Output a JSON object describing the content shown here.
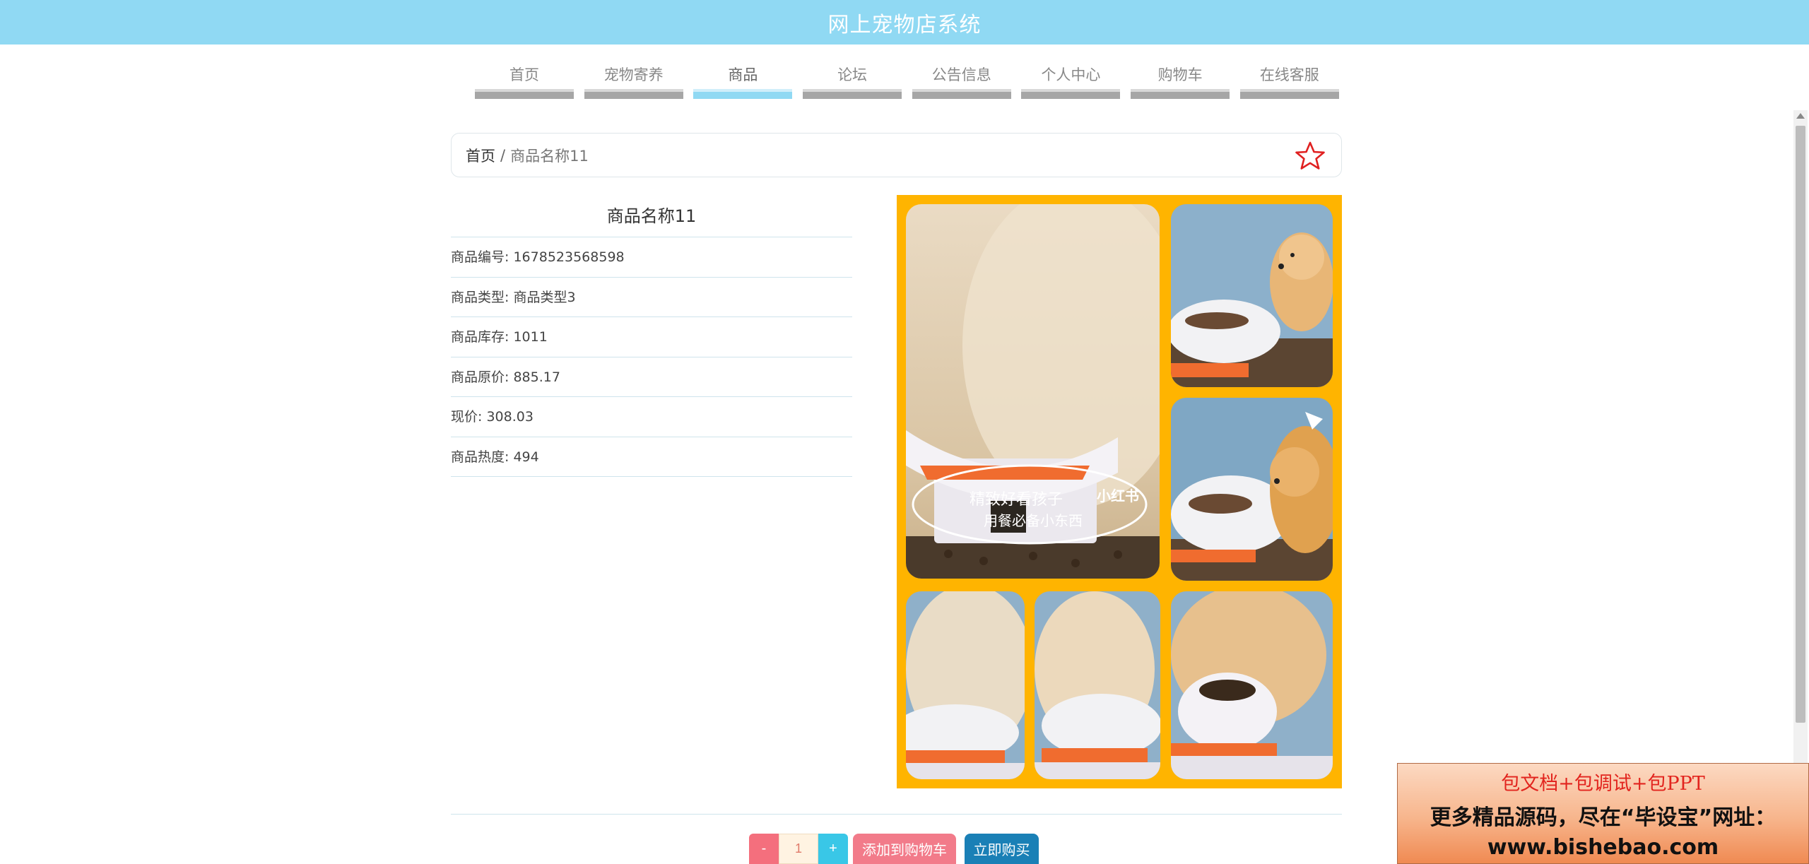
{
  "header": {
    "title": "网上宠物店系统",
    "bg_color": "#90d9f3"
  },
  "nav": {
    "active_index": 2,
    "items": [
      {
        "label": "首页"
      },
      {
        "label": "宠物寄养"
      },
      {
        "label": "商品"
      },
      {
        "label": "论坛"
      },
      {
        "label": "公告信息"
      },
      {
        "label": "个人中心"
      },
      {
        "label": "购物车"
      },
      {
        "label": "在线客服"
      }
    ]
  },
  "breadcrumb": {
    "home": "首页",
    "separator": "/",
    "current": "商品名称11",
    "favorite_icon": "star-outline-icon",
    "favorite_color": "#e02020"
  },
  "product": {
    "name": "商品名称11",
    "fields": [
      {
        "label": "商品编号",
        "value": "1678523568598"
      },
      {
        "label": "商品类型",
        "value": "商品类型3"
      },
      {
        "label": "商品库存",
        "value": "1011"
      },
      {
        "label": "商品原价",
        "value": "885.17"
      },
      {
        "label": "现价",
        "value": "308.03"
      },
      {
        "label": "商品热度",
        "value": "494"
      }
    ]
  },
  "gallery": {
    "bg_color": "#ffb400",
    "photo_caption_1": "精致好看孩子",
    "photo_caption_2": "用餐必备小东西",
    "photo_watermark": "小红书"
  },
  "actions": {
    "minus_label": "-",
    "quantity": "1",
    "plus_label": "+",
    "add_to_cart": "添加到购物车",
    "buy_now": "立即购买"
  },
  "ad": {
    "line1": "包文档+包调试+包PPT",
    "line2": "更多精品源码，尽在“毕设宝”网址：",
    "line3": "www.bishebao.com"
  }
}
